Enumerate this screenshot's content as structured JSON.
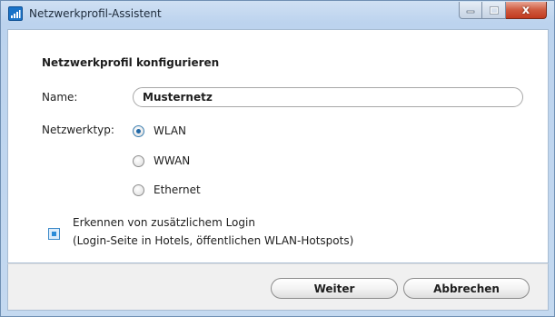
{
  "window": {
    "title": "Netzwerkprofil-Assistent",
    "close_glyph": "x"
  },
  "form": {
    "heading": "Netzwerkprofil konfigurieren",
    "name_label": "Name:",
    "name_value": "Musternetz",
    "type_label": "Netzwerktyp:",
    "type_options": [
      {
        "label": "WLAN",
        "selected": true
      },
      {
        "label": "WWAN",
        "selected": false
      },
      {
        "label": "Ethernet",
        "selected": false
      }
    ],
    "login_checkbox": {
      "checked": true,
      "line1": "Erkennen von zusätzlichem Login",
      "line2": "(Login-Seite in Hotels, öffentlichen WLAN-Hotspots)"
    }
  },
  "buttons": {
    "next": "Weiter",
    "cancel": "Abbrechen"
  },
  "colors": {
    "title_bar": "#c4d9f0",
    "close_button": "#c23a1f",
    "accent_blue": "#1f67a6"
  }
}
